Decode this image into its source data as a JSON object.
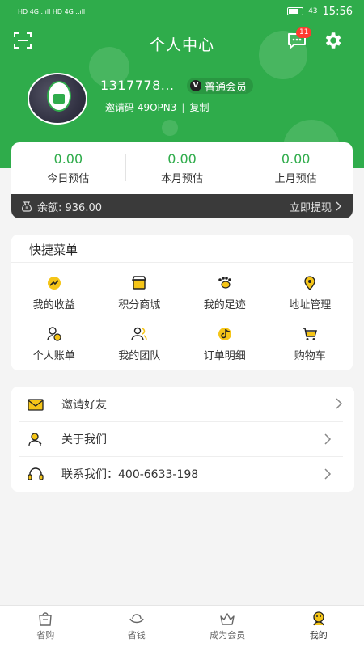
{
  "status_bar": {
    "left": "HD 4G ..ıll HD 4G ..ıll",
    "battery": "43",
    "time": "15:56"
  },
  "header": {
    "title": "个人中心",
    "message_badge": "11",
    "user": {
      "phone": "1317778...",
      "member_level": "普通会员",
      "member_mark": "V",
      "invite_code": "邀请码 49OPN3",
      "copy": "复制"
    }
  },
  "earnings": [
    {
      "value": "0.00",
      "label": "今日预估"
    },
    {
      "value": "0.00",
      "label": "本月预估"
    },
    {
      "value": "0.00",
      "label": "上月预估"
    }
  ],
  "balance": {
    "text": "余额: 936.00",
    "action": "立即提现"
  },
  "quick_menu": {
    "title": "快捷菜单",
    "items": [
      {
        "label": "我的收益",
        "icon": "earnings-icon"
      },
      {
        "label": "积分商城",
        "icon": "points-mall-icon"
      },
      {
        "label": "我的足迹",
        "icon": "footprint-icon"
      },
      {
        "label": "地址管理",
        "icon": "location-icon"
      },
      {
        "label": "个人账单",
        "icon": "bill-icon"
      },
      {
        "label": "我的团队",
        "icon": "team-icon"
      },
      {
        "label": "订单明细",
        "icon": "order-icon"
      },
      {
        "label": "购物车",
        "icon": "cart-icon"
      }
    ]
  },
  "list": [
    {
      "label": "邀请好友",
      "icon": "envelope-icon"
    },
    {
      "label": "关于我们",
      "icon": "about-icon"
    },
    {
      "label": "联系我们：400-6633-198",
      "icon": "headset-icon"
    }
  ],
  "tabbar": [
    {
      "label": "省购",
      "icon": "shop-bag-icon"
    },
    {
      "label": "省钱",
      "icon": "ingot-icon"
    },
    {
      "label": "成为会员",
      "icon": "crown-icon"
    },
    {
      "label": "我的",
      "icon": "profile-icon",
      "active": true
    }
  ],
  "colors": {
    "brand_green": "#2fac4b",
    "accent_yellow": "#f5c518",
    "balance_bar": "#3a3a3a"
  }
}
